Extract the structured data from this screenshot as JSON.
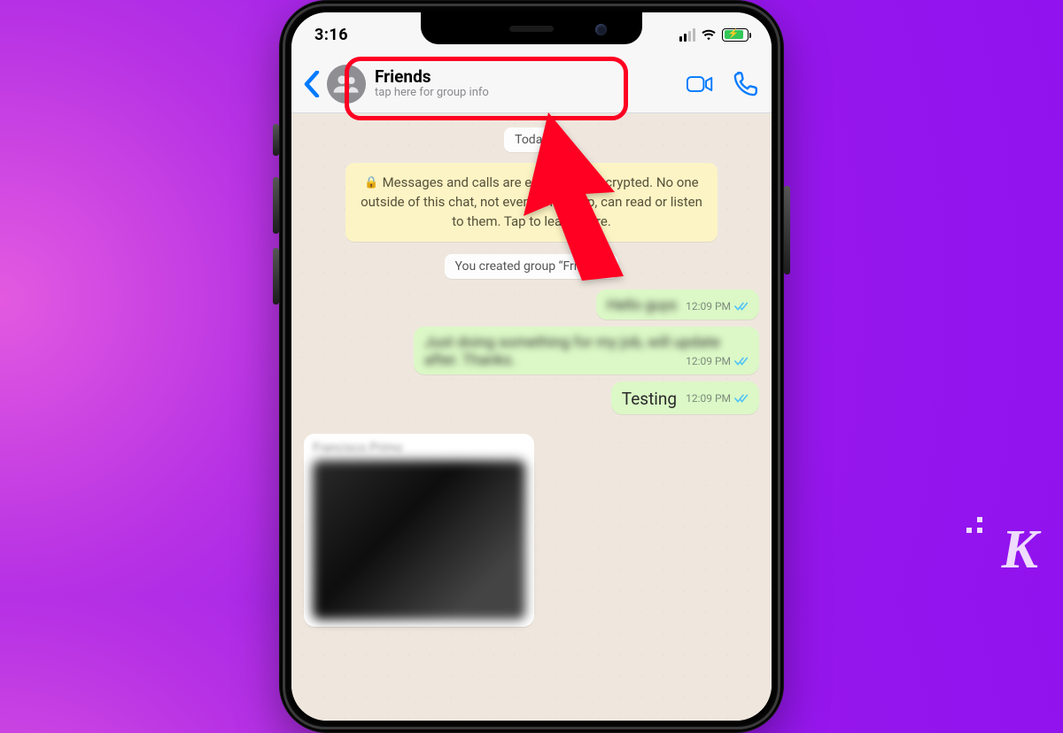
{
  "status": {
    "time": "3:16"
  },
  "header": {
    "title": "Friends",
    "subtitle": "tap here for group info"
  },
  "chat": {
    "date_pill": "Today",
    "e2e_notice": "Messages and calls are end-to-end encrypted. No one outside of this chat, not even WhatsApp, can read or listen to them. Tap to learn more.",
    "system_created": "You created group “Friends”",
    "messages": [
      {
        "body": "Hello guys",
        "time": "12:09 PM",
        "blurred": true
      },
      {
        "body": "Just doing something for my job, will update after. Thanks.",
        "time": "12:09 PM",
        "blurred": true
      },
      {
        "body": "Testing",
        "time": "12:09 PM",
        "blurred": false
      }
    ],
    "incoming_sender": "Francisco Primo"
  },
  "colors": {
    "accent": "#ff0022",
    "ios_blue": "#007aff",
    "bubble_out": "#dbf8c6"
  },
  "watermark": "K"
}
